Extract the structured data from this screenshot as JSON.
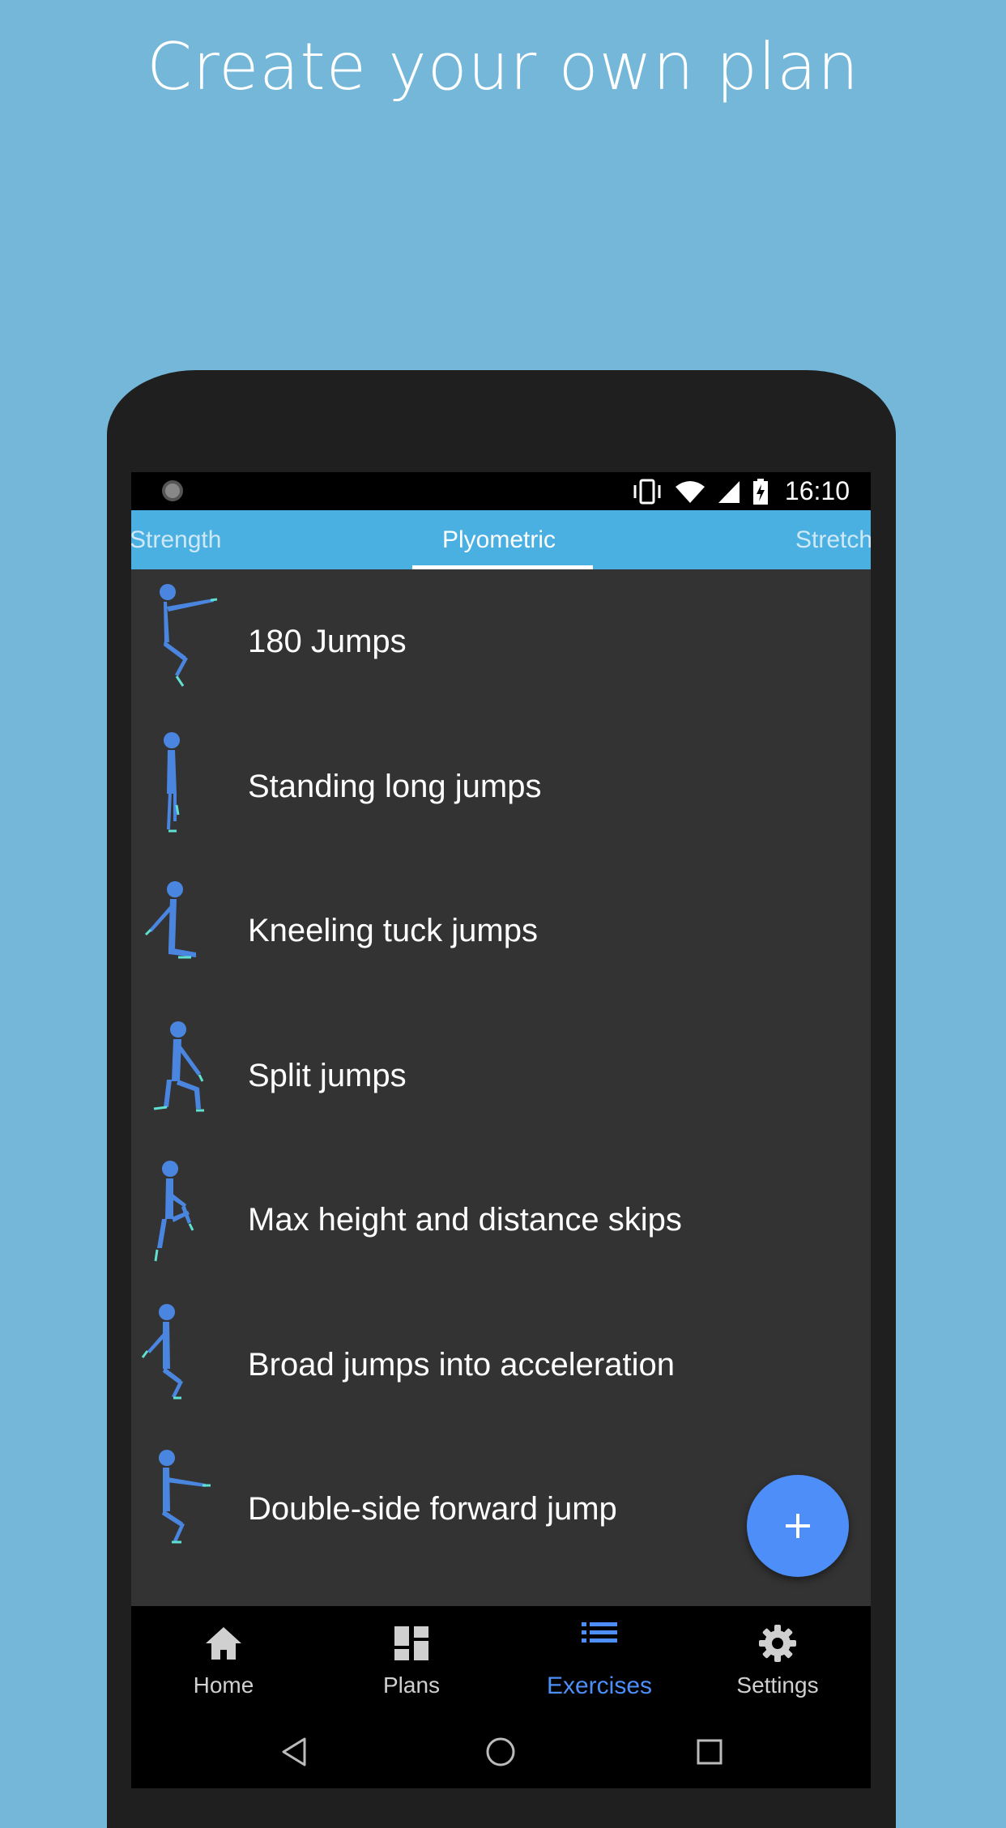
{
  "headline": "Create your own plan",
  "status_bar": {
    "time": "16:10",
    "icons": [
      "notification-icon",
      "vibrate-icon",
      "wifi-icon",
      "signal-icon",
      "battery-charging-icon"
    ]
  },
  "tabs": [
    {
      "label": "Strength",
      "active": false
    },
    {
      "label": "Plyometric",
      "active": true
    },
    {
      "label": "Stretch",
      "active": false
    }
  ],
  "exercises": [
    {
      "name": "180 Jumps"
    },
    {
      "name": "Standing long jumps"
    },
    {
      "name": "Kneeling tuck jumps"
    },
    {
      "name": "Split jumps"
    },
    {
      "name": "Max height and distance skips"
    },
    {
      "name": "Broad jumps into acceleration"
    },
    {
      "name": "Double-side forward jump"
    }
  ],
  "fab": {
    "icon": "plus-icon"
  },
  "bottom_nav": [
    {
      "label": "Home",
      "icon": "home-icon"
    },
    {
      "label": "Plans",
      "icon": "dashboard-icon"
    },
    {
      "label": "Exercises",
      "icon": "list-icon",
      "active": true
    },
    {
      "label": "Settings",
      "icon": "gear-icon"
    }
  ],
  "system_nav": [
    "back-icon",
    "home-circle-icon",
    "recents-icon"
  ],
  "colors": {
    "background": "#74b7d8",
    "tab_bar": "#4ab0e2",
    "accent": "#4d8ef8",
    "list_background": "#333333",
    "figure": "#4a86e0"
  }
}
